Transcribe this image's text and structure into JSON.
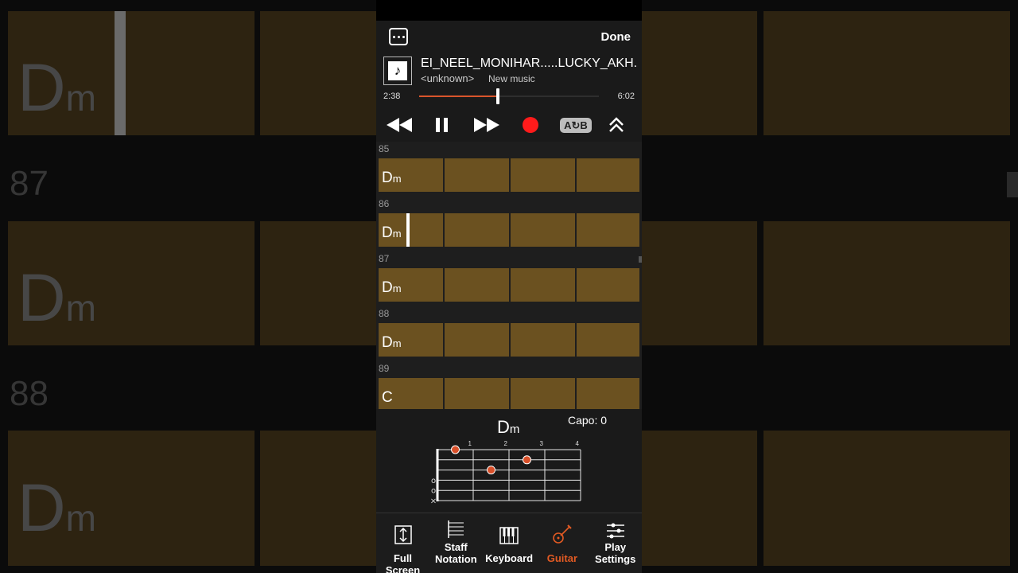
{
  "header": {
    "done_label": "Done"
  },
  "song": {
    "title": "EI_NEEL_MONIHAR.....LUCKY_AKH...",
    "artist": "<unknown>",
    "album": "New music",
    "elapsed": "2:38",
    "duration": "6:02",
    "progress_fraction": 0.437
  },
  "controls": {
    "ab_label": "A↻B"
  },
  "measures": [
    {
      "number": "85",
      "chord_root": "D",
      "chord_quality": "m",
      "playhead": false
    },
    {
      "number": "86",
      "chord_root": "D",
      "chord_quality": "m",
      "playhead": true
    },
    {
      "number": "87",
      "chord_root": "D",
      "chord_quality": "m",
      "playhead": false
    },
    {
      "number": "88",
      "chord_root": "D",
      "chord_quality": "m",
      "playhead": false
    },
    {
      "number": "89",
      "chord_root": "C",
      "chord_quality": "",
      "playhead": false
    }
  ],
  "diagram": {
    "chord_root": "D",
    "chord_quality": "m",
    "capo_label": "Capo: 0",
    "fret_labels": [
      "1",
      "2",
      "3",
      "4"
    ],
    "open_string_marks": [
      "o",
      "o",
      "×"
    ],
    "dots": [
      {
        "string": 1,
        "fret": 1
      },
      {
        "string": 2,
        "fret": 3
      },
      {
        "string": 3,
        "fret": 2
      }
    ],
    "dot_color": "#d9502a"
  },
  "tabs": [
    {
      "line1": "Full Screen",
      "line2": "",
      "icon": "full-screen-icon",
      "active": false
    },
    {
      "line1": "Staff",
      "line2": "Notation",
      "icon": "staff-notation-icon",
      "active": false
    },
    {
      "line1": "Keyboard",
      "line2": "",
      "icon": "keyboard-icon",
      "active": false
    },
    {
      "line1": "Guitar",
      "line2": "",
      "icon": "guitar-icon",
      "active": true
    },
    {
      "line1": "Play",
      "line2": "Settings",
      "icon": "sliders-icon",
      "active": false
    }
  ],
  "colors": {
    "accent": "#e25a23",
    "measure_cell": "#6b5120",
    "record": "#ff1b1b"
  }
}
